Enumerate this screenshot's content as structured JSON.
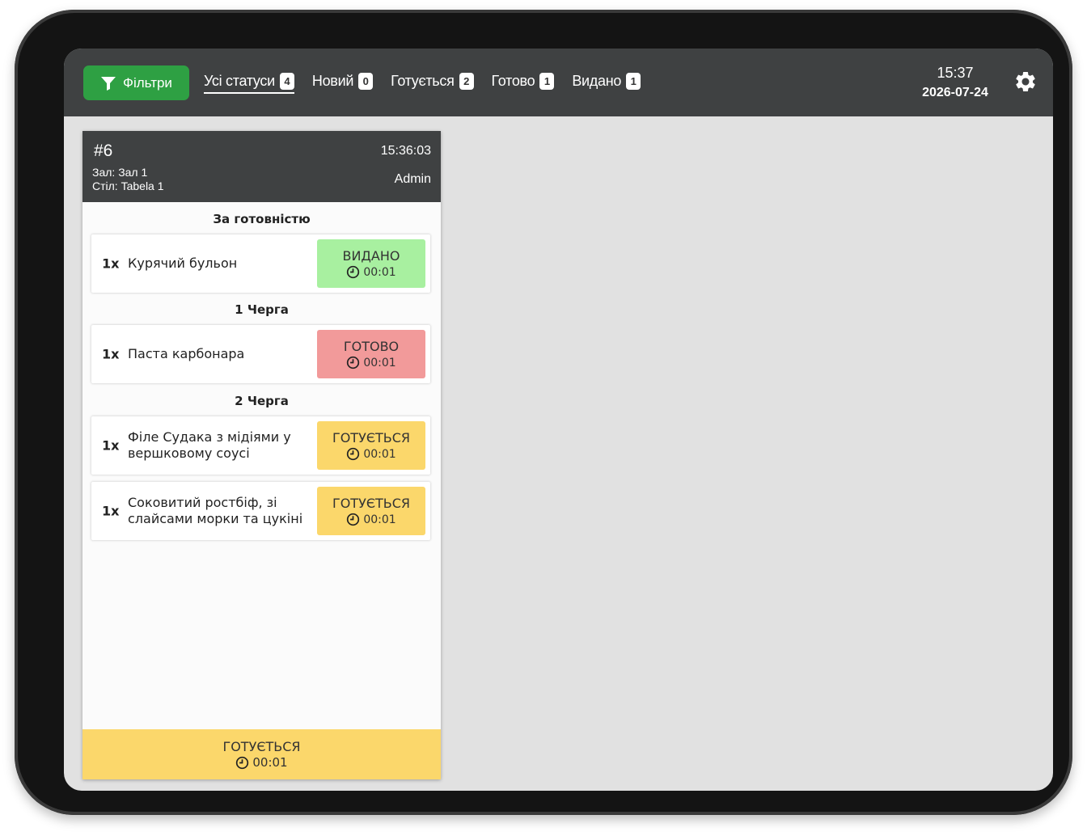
{
  "colors": {
    "topbar": "#3f4142",
    "filter_green": "#2ea043",
    "issued_green": "#a8f0a0",
    "ready_red": "#f29a9a",
    "cooking_yellow": "#fbd76b"
  },
  "header": {
    "filter_label": "Фільтри",
    "tabs": [
      {
        "label": "Усі статуси",
        "count": "4"
      },
      {
        "label": "Новий",
        "count": "0"
      },
      {
        "label": "Готується",
        "count": "2"
      },
      {
        "label": "Готово",
        "count": "1"
      },
      {
        "label": "Видано",
        "count": "1"
      }
    ],
    "time": "15:37",
    "date": "2026-07-24",
    "settings_icon": "gear-icon"
  },
  "order": {
    "number": "#6",
    "time": "15:36:03",
    "hall": "Зал: Зал 1",
    "table": "Стіл: Tabela 1",
    "user": "Admin",
    "sections": [
      {
        "title": "За готовністю",
        "items": [
          {
            "qty": "1x",
            "name": "Курячий бульон",
            "status": "ВИДАНО",
            "timer": "00:01",
            "color": "#a8f0a0"
          }
        ]
      },
      {
        "title": "1 Черга",
        "items": [
          {
            "qty": "1x",
            "name": "Паста карбонара",
            "status": "ГОТОВО",
            "timer": "00:01",
            "color": "#f29a9a"
          }
        ]
      },
      {
        "title": "2 Черга",
        "items": [
          {
            "qty": "1x",
            "name": "Філе Судака з мідіями у вершковому соусі",
            "status": "ГОТУЄТЬСЯ",
            "timer": "00:01",
            "color": "#fbd76b"
          },
          {
            "qty": "1x",
            "name": "Соковитий ростбіф, зі слайсами морки та цукіні",
            "status": "ГОТУЄТЬСЯ",
            "timer": "00:01",
            "color": "#fbd76b"
          }
        ]
      }
    ],
    "footer": {
      "status": "ГОТУЄТЬСЯ",
      "timer": "00:01"
    }
  }
}
